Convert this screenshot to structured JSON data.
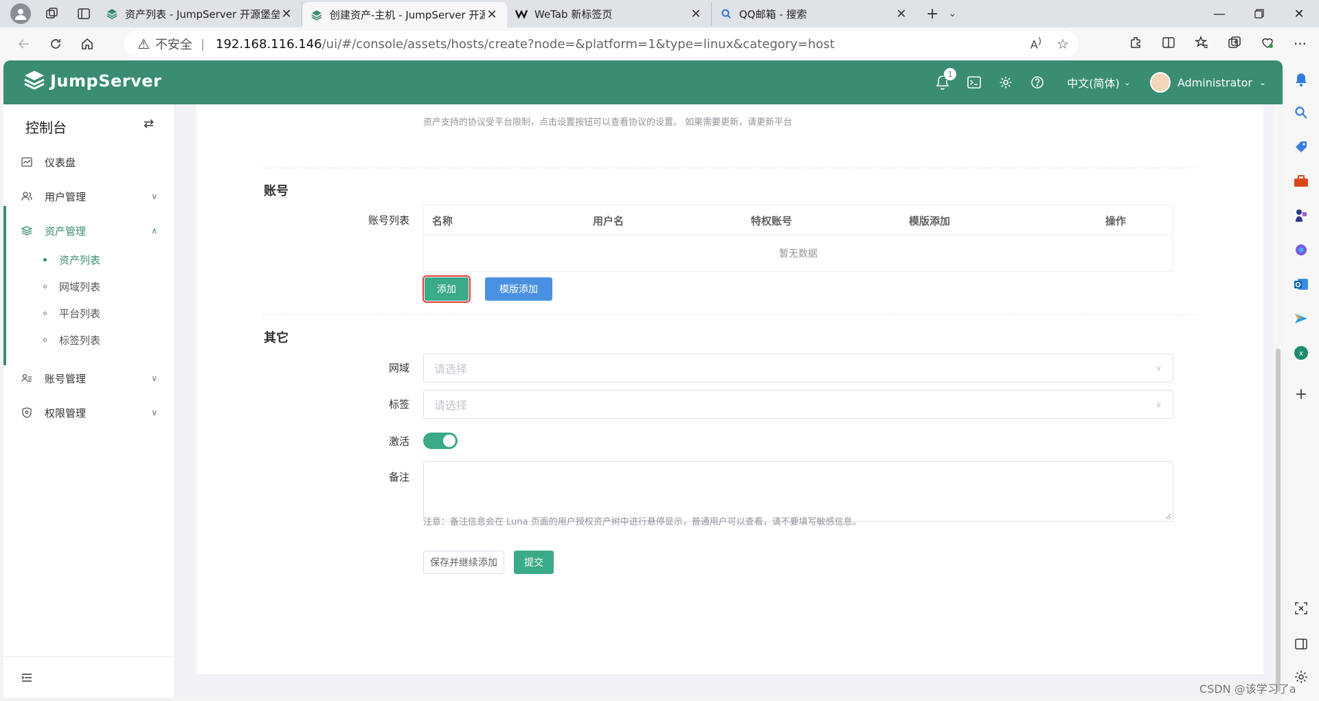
{
  "browser": {
    "tabs": [
      {
        "title": "资产列表 - JumpServer 开源堡垒",
        "active": false
      },
      {
        "title": "创建资产-主机 - JumpServer 开源",
        "active": true
      },
      {
        "title": "WeTab 新标签页",
        "active": false
      },
      {
        "title": "QQ邮箱 - 搜索",
        "active": false
      }
    ],
    "address": {
      "security_label": "不安全",
      "host": "192.168.116.146",
      "path": "/ui/#/console/assets/hosts/create?node=&platform=1&type=linux&category=host"
    }
  },
  "app": {
    "brand": "JumpServer",
    "accent_color": "#3a8c73",
    "notification_count": "1",
    "language": "中文(简体)",
    "username": "Administrator"
  },
  "sidebar": {
    "title": "控制台",
    "items": [
      {
        "label": "仪表盘",
        "icon": "dashboard-icon"
      },
      {
        "label": "用户管理",
        "icon": "users-icon"
      },
      {
        "label": "资产管理",
        "icon": "layers-icon"
      },
      {
        "label": "账号管理",
        "icon": "account-icon"
      },
      {
        "label": "权限管理",
        "icon": "shield-icon"
      }
    ],
    "asset_sub_items": [
      "资产列表",
      "网域列表",
      "平台列表",
      "标签列表"
    ]
  },
  "form": {
    "protocol_hint": "资产支持的协议受平台限制，点击设置按钮可以查看协议的设置。 如果需要更新，请更新平台",
    "accounts_section": "账号",
    "account_list_label": "账号列表",
    "account_table": {
      "columns": [
        "名称",
        "用户名",
        "特权账号",
        "模版添加",
        "操作"
      ],
      "empty_text": "暂无数据"
    },
    "add_button": "添加",
    "template_add_button": "模版添加",
    "other_section": "其它",
    "domain_label": "网域",
    "domain_placeholder": "请选择",
    "labels_label": "标签",
    "labels_placeholder": "请选择",
    "active_label": "激活",
    "active_value": true,
    "comment_label": "备注",
    "comment_note": "注意：备注信息会在 Luna 页面的用户授权资产树中进行悬停显示，普通用户可以查看，请不要填写敏感信息。",
    "save_continue_button": "保存并继续添加",
    "submit_button": "提交"
  },
  "watermark": "CSDN @该学习了a"
}
